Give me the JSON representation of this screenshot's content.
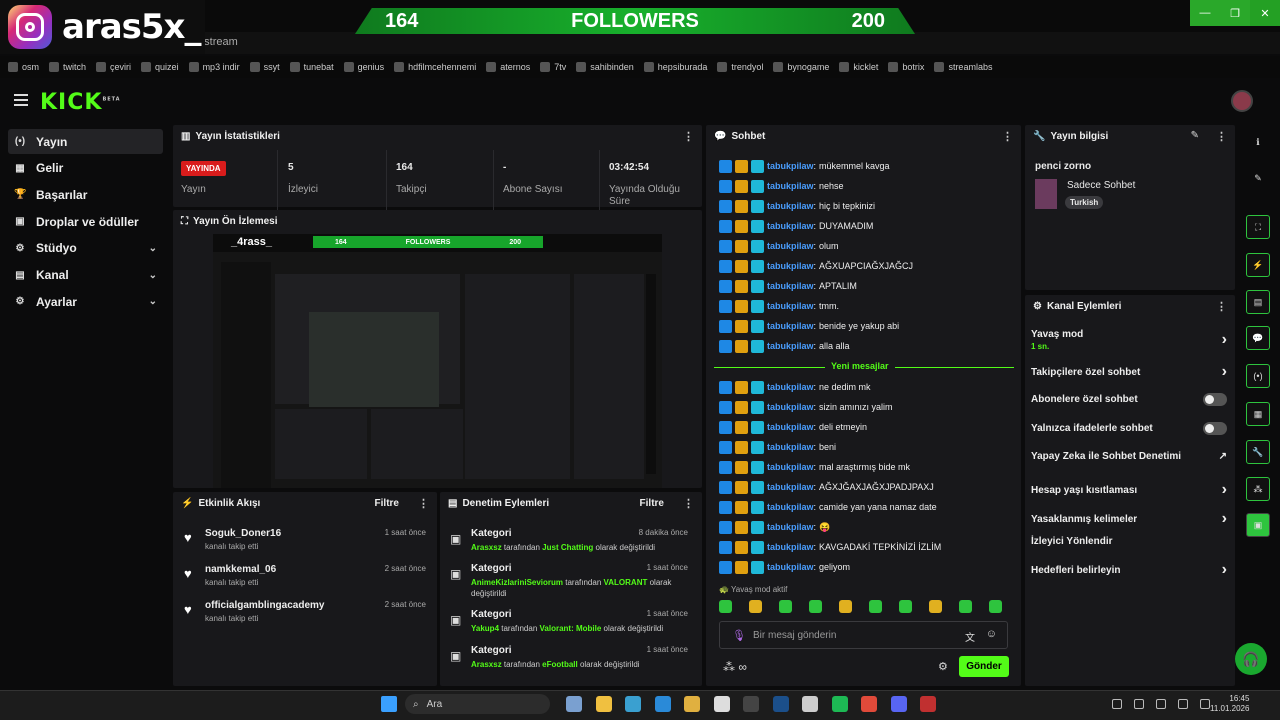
{
  "overlay": {
    "name": "aras5x_",
    "left_count": "164",
    "label": "FOLLOWERS",
    "right_count": "200"
  },
  "browser": {
    "url": "n/stream",
    "bookmarks": [
      "osm",
      "twitch",
      "çeviri",
      "quizei",
      "mp3 indir",
      "ssyt",
      "tunebat",
      "genius",
      "hdfilmcehennemi",
      "aternos",
      "7tv",
      "sahibinden",
      "hepsiburada",
      "trendyol",
      "bynogame",
      "kicklet",
      "botrix",
      "streamlabs"
    ]
  },
  "header": {
    "logo": "KICK",
    "logo_sup": "BETA"
  },
  "sidebar": {
    "items": [
      {
        "label": "Yayın",
        "icon": "(•)"
      },
      {
        "label": "Gelir",
        "icon": "▦"
      },
      {
        "label": "Başarılar",
        "icon": "🏆"
      },
      {
        "label": "Droplar ve ödüller",
        "icon": "▣"
      },
      {
        "label": "Stüdyo",
        "icon": "⚙"
      },
      {
        "label": "Kanal",
        "icon": "▤"
      },
      {
        "label": "Ayarlar",
        "icon": "⚙"
      }
    ]
  },
  "stats": {
    "title": "Yayın İstatistikleri",
    "live_badge": "YAYINDA",
    "live_label": "Yayın",
    "items": [
      {
        "value": "5",
        "label": "İzleyici"
      },
      {
        "value": "164",
        "label": "Takipçi"
      },
      {
        "value": "-",
        "label": "Abone Sayısı"
      },
      {
        "value": "03:42:54",
        "label": "Yayında Olduğu Süre"
      }
    ]
  },
  "preview": {
    "title": "Yayın Ön İzlemesi",
    "mini_name": "_4rass_",
    "mini_left": "164",
    "mini_label": "FOLLOWERS",
    "mini_right": "200"
  },
  "activity": {
    "title": "Etkinlik Akışı",
    "filter": "Filtre",
    "items": [
      {
        "user": "Soguk_Doner16",
        "sub": "kanalı takip etti",
        "time": "1 saat önce"
      },
      {
        "user": "namkkemal_06",
        "sub": "kanalı takip etti",
        "time": "2 saat önce"
      },
      {
        "user": "officialgamblingacademy",
        "sub": "kanalı takip etti",
        "time": "2 saat önce"
      }
    ]
  },
  "moderation": {
    "title": "Denetim Eylemleri",
    "filter": "Filtre",
    "items": [
      {
        "title": "Kategori",
        "time": "8 dakika önce",
        "user": "Arasxsz",
        "mid": " tarafından ",
        "cat": "Just Chatting",
        "tail": " olarak değiştirildi"
      },
      {
        "title": "Kategori",
        "time": "1 saat önce",
        "user": "AnimeKizlariniSeviorum",
        "mid": " tarafından ",
        "cat": "VALORANT",
        "tail": " olarak değiştirildi"
      },
      {
        "title": "Kategori",
        "time": "1 saat önce",
        "user": "Yakup4",
        "mid": " tarafından ",
        "cat": "Valorant: Mobile",
        "tail": " olarak değiştirildi"
      },
      {
        "title": "Kategori",
        "time": "1 saat önce",
        "user": "Arasxsz",
        "mid": " tarafından ",
        "cat": "eFootball",
        "tail": " olarak değiştirildi"
      }
    ]
  },
  "chat": {
    "title": "Sohbet",
    "user": "tabukpilaw",
    "messages_before": [
      "mükemmel kavga",
      "nehse",
      "hiç bi tepkinizi",
      "DUYAMADIM",
      "olum",
      "AĞXUAPCIAĞXJAĞCJ",
      "APTALIM",
      "tmm.",
      "benide ye yakup abi",
      "alla alla"
    ],
    "divider": "Yeni mesajlar",
    "messages_after": [
      "ne dedim mk",
      "sizin amınızı yalim",
      "deli etmeyin",
      "beni",
      "mal araştırmış bide mk",
      "AĞXJĞAXJAĞXJPADJPAXJ",
      "camide yan yana namaz date",
      "😝",
      "KAVGADAKİ TEPKİNİZİ İZLİM",
      "geliyom"
    ],
    "slow_mode": "Yavaş mod aktif",
    "placeholder": "Bir mesaj gönderin",
    "send": "Gönder"
  },
  "info": {
    "title": "Yayın bilgisi",
    "stream_title": "penci zorno",
    "category": "Sadece Sohbet",
    "language": "Turkish"
  },
  "channel_actions": {
    "title": "Kanal Eylemleri",
    "items": [
      {
        "label": "Yavaş mod",
        "sub": "1 sn.",
        "control": "chevron"
      },
      {
        "label": "Takipçilere özel sohbet",
        "sub": "",
        "control": "chevron"
      },
      {
        "label": "Abonelere özel sohbet",
        "sub": "",
        "control": "toggle"
      },
      {
        "label": "Yalnızca ifadelerle sohbet",
        "sub": "",
        "control": "toggle"
      },
      {
        "label": "Yapay Zeka ile Sohbet Denetimi",
        "sub": "",
        "control": "external"
      },
      {
        "label": "Hesap yaşı kısıtlaması",
        "sub": "",
        "control": "chevron"
      },
      {
        "label": "Yasaklanmış kelimeler",
        "sub": "",
        "control": "chevron"
      },
      {
        "label": "İzleyici Yönlendir",
        "sub": "",
        "control": "none"
      },
      {
        "label": "Hedefleri belirleyin",
        "sub": "",
        "control": "chevron"
      }
    ]
  },
  "taskbar": {
    "search": "Ara",
    "time": "16:45",
    "date": "11.01.2026"
  }
}
